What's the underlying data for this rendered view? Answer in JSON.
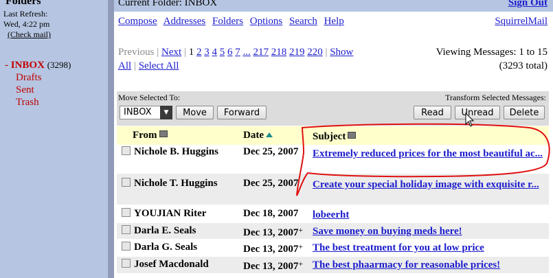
{
  "sidebar": {
    "heading": "Folders",
    "last_refresh_label": "Last Refresh:",
    "last_refresh_value": "Wed, 4:22 pm",
    "check_mail": "(Check mail)",
    "folders": [
      {
        "label": "INBOX",
        "count": "(3298)"
      },
      {
        "label": "Drafts"
      },
      {
        "label": "Sent"
      },
      {
        "label": "Trash"
      }
    ]
  },
  "header": {
    "current_folder": "Current Folder: INBOX",
    "sign_out": "Sign Out",
    "menu": [
      "Compose",
      "Addresses",
      "Folders",
      "Options",
      "Search",
      "Help"
    ],
    "brand_link": "SquirrelMail"
  },
  "pager": {
    "previous": "Previous",
    "next": "Next",
    "current": "1",
    "pages": [
      "2",
      "3",
      "4",
      "5",
      "6",
      "7"
    ],
    "ellipsis": "...",
    "last_pages": [
      "217",
      "218",
      "219",
      "220"
    ],
    "show": "Show",
    "all": "All",
    "select_all": "Select All",
    "viewing": "Viewing Messages: 1 to 15",
    "total": "(3293 total)"
  },
  "toolbar": {
    "move_label": "Move Selected To:",
    "transform_label": "Transform Selected Messages:",
    "folder_select": "INBOX",
    "move": "Move",
    "forward": "Forward",
    "read": "Read",
    "unread": "Unread",
    "delete": "Delete"
  },
  "table": {
    "headers": {
      "from": "From",
      "date": "Date",
      "subject": "Subject"
    },
    "rows": [
      {
        "from": "Nichole B. Huggins",
        "date": "Dec 25, 2007",
        "plus": "",
        "subject": "Extremely reduced prices for the most beautiful ac..."
      },
      {
        "from": "Nichole T. Huggins",
        "date": "Dec 25, 2007",
        "plus": "",
        "subject": "Create your special holiday image with exquisite r..."
      },
      {
        "from": "YOUJIAN Riter",
        "date": "Dec 18, 2007",
        "plus": "",
        "subject": "lobeerht"
      },
      {
        "from": "Darla E. Seals",
        "date": "Dec 13, 2007",
        "plus": "+",
        "subject": "Save money on buying meds here!"
      },
      {
        "from": "Darla G. Seals",
        "date": "Dec 13, 2007",
        "plus": "+",
        "subject": "The best treatment for you at low price"
      },
      {
        "from": "Josef Macdonald",
        "date": "Dec 13, 2007",
        "plus": "+",
        "subject": "The best phaarmacy for reasonable prices!"
      }
    ]
  },
  "colors": {
    "sidebar_bg": "#b6c6e2",
    "link": "#1c1ccc",
    "folder_red": "#c10000",
    "header_row": "#ffffcc",
    "annotation": "#e01010"
  }
}
